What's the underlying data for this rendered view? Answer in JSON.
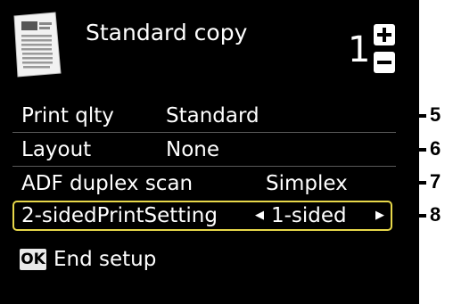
{
  "header": {
    "title": "Standard copy",
    "copies": "1",
    "icon": "document-icon",
    "stepper_icon": "plus-minus-icon"
  },
  "settings": [
    {
      "label": "Print qlty",
      "value": "Standard",
      "callout": "5"
    },
    {
      "label": "Layout",
      "value": "None",
      "callout": "6"
    },
    {
      "label": "ADF duplex scan",
      "value": "Simplex",
      "callout": "7"
    },
    {
      "label": "2-sidedPrintSetting",
      "value": "1-sided",
      "callout": "8",
      "selected": true
    }
  ],
  "footer": {
    "ok_key": "OK",
    "action": "End setup"
  },
  "colors": {
    "screen_bg": "#000000",
    "text": "#ffffff",
    "selection_border": "#e8d84a"
  }
}
